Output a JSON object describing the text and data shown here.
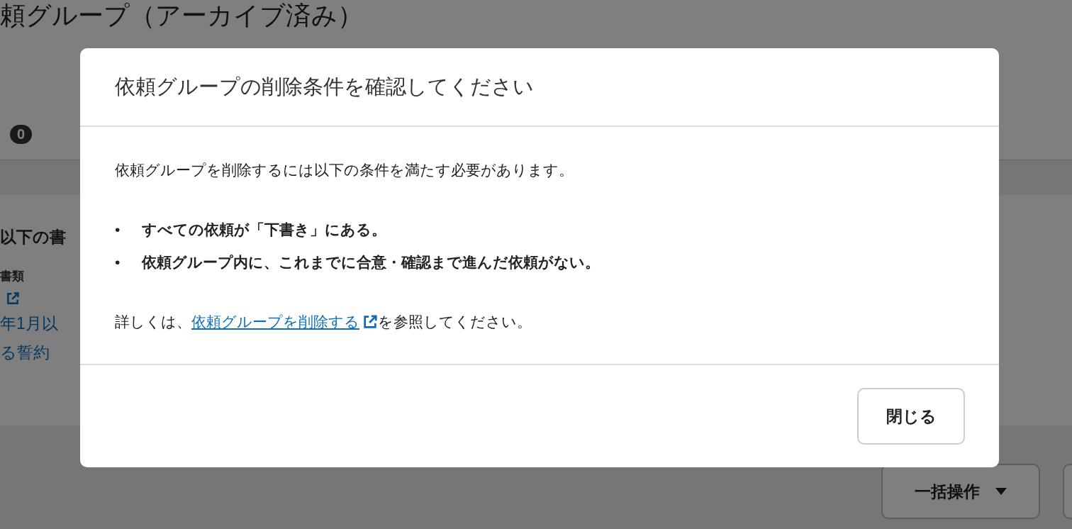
{
  "page": {
    "title": "頼グループ（アーカイブ済み）",
    "count_badge": "0"
  },
  "card": {
    "heading": "以下の書",
    "lines": [
      {
        "kind": "label",
        "text": "書類"
      },
      {
        "kind": "icon-link"
      },
      {
        "kind": "link",
        "text": "年1月以"
      },
      {
        "kind": "link",
        "text": "る誓約"
      }
    ]
  },
  "bulk_button": {
    "label": "一括操作"
  },
  "dialog": {
    "title": "依頼グループの削除条件を確認してください",
    "intro": "依頼グループを削除するには以下の条件を満たす必要があります。",
    "bullet": "•",
    "conditions": [
      "すべての依頼が「下書き」にある。",
      "依頼グループ内に、これまでに合意・確認まで進んだ依頼がない。"
    ],
    "note_before": "詳しくは、",
    "note_link": "依頼グループを削除する",
    "note_after": "を参照してください。",
    "close_button": "閉じる"
  }
}
